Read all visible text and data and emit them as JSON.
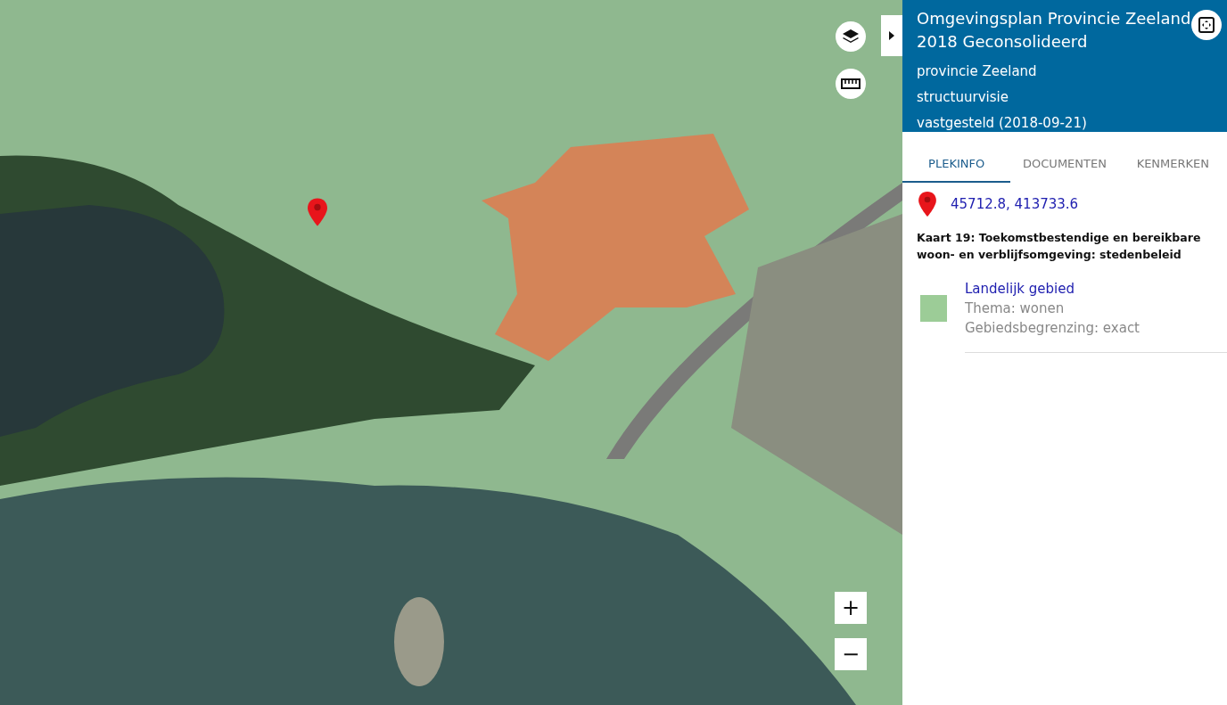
{
  "map": {
    "zoom_in": "+",
    "zoom_out": "−"
  },
  "panel": {
    "title": "Omgevingsplan Provincie Zeeland 2018 Geconsolideerd",
    "owner": "provincie Zeeland",
    "type": "structuurvisie",
    "status": "vastgesteld (2018-09-21)"
  },
  "tabs": [
    {
      "label": "PLEKINFO",
      "selected": true
    },
    {
      "label": "DOCUMENTEN",
      "selected": false
    },
    {
      "label": "KENMERKEN",
      "selected": false
    }
  ],
  "location": {
    "coordinates": "45712.8, 413733.6"
  },
  "map_title": "Kaart 19: Toekomstbestendige en bereikbare woon- en verblijfsomgeving: stedenbeleid",
  "legend": [
    {
      "name": "Landelijk gebied",
      "theme": "Thema: wonen",
      "boundary": "Gebiedsbegrenzing: exact",
      "color": "#9ccc97"
    }
  ]
}
